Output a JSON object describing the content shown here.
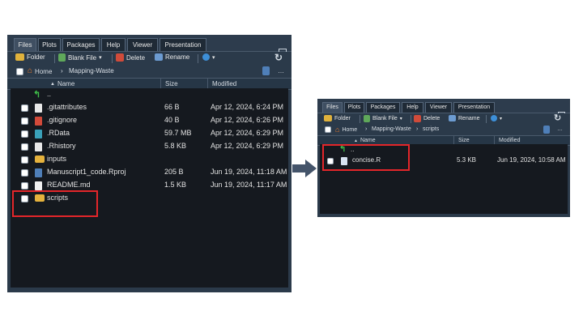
{
  "tabs": [
    "Files",
    "Plots",
    "Packages",
    "Help",
    "Viewer",
    "Presentation"
  ],
  "toolbar": {
    "new_folder": "Folder",
    "blank_file": "Blank File",
    "delete": "Delete",
    "rename": "Rename"
  },
  "columns": {
    "name": "Name",
    "size": "Size",
    "modified": "Modified"
  },
  "left_pane": {
    "breadcrumb": [
      "Home",
      "Mapping-Waste"
    ],
    "parent_row": "..",
    "files": [
      {
        "name": ".gitattributes",
        "size": "66 B",
        "modified": "Apr 12, 2024, 6:24 PM",
        "icon": "text-file-icon"
      },
      {
        "name": ".gitignore",
        "size": "40 B",
        "modified": "Apr 12, 2024, 6:26 PM",
        "icon": "gitignore-icon"
      },
      {
        "name": ".RData",
        "size": "59.7 MB",
        "modified": "Apr 12, 2024, 6:29 PM",
        "icon": "rdata-icon"
      },
      {
        "name": ".Rhistory",
        "size": "5.8 KB",
        "modified": "Apr 12, 2024, 6:29 PM",
        "icon": "rhistory-icon"
      },
      {
        "name": "inputs",
        "size": "",
        "modified": "",
        "icon": "folder-icon"
      },
      {
        "name": "Manuscript1_code.Rproj",
        "size": "205 B",
        "modified": "Jun 19, 2024, 11:18 AM",
        "icon": "rproj-icon"
      },
      {
        "name": "README.md",
        "size": "1.5 KB",
        "modified": "Jun 19, 2024, 11:17 AM",
        "icon": "markdown-icon"
      },
      {
        "name": "scripts",
        "size": "",
        "modified": "",
        "icon": "folder-icon"
      }
    ]
  },
  "right_pane": {
    "breadcrumb": [
      "Home",
      "Mapping-Waste",
      "scripts"
    ],
    "parent_row": "..",
    "files": [
      {
        "name": "concise.R",
        "size": "5.3 KB",
        "modified": "Jun 19, 2024, 10:58 AM",
        "icon": "r-script-icon"
      }
    ]
  },
  "colors": {
    "highlight": "#e3262a",
    "pane_chrome": "#2b3a4a",
    "list_background": "#15191f",
    "arrow": "#44546a"
  }
}
